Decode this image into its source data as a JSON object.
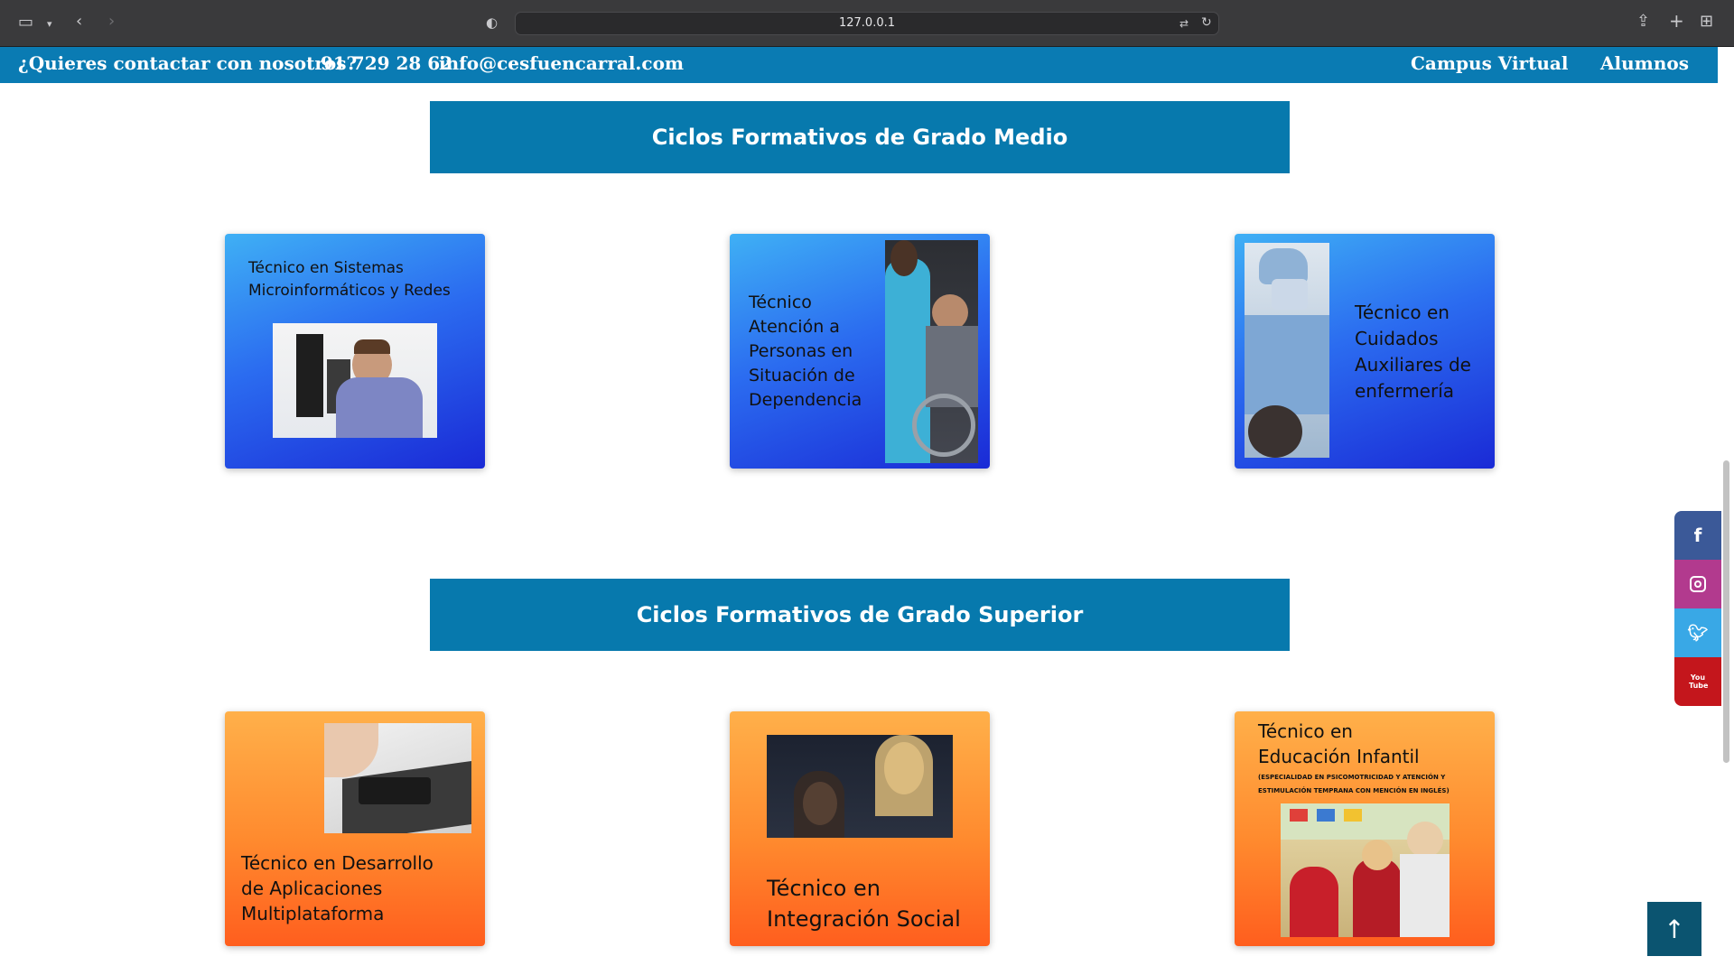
{
  "browser": {
    "url": "127.0.0.1"
  },
  "topbar": {
    "contact_question": "¿Quieres contactar con nosotros?",
    "phone": "91 729 28 62",
    "email": "info@cesfuencarral.com",
    "campus_virtual": "Campus Virtual",
    "alumnos": "Alumnos"
  },
  "sections": {
    "grado_medio": {
      "heading": "Ciclos Formativos de Grado Medio",
      "cards": [
        {
          "title_line1": "Técnico en Sistemas",
          "title_line2": "Microinformáticos y Redes"
        },
        {
          "lines": [
            "Técnico",
            "Atención a",
            "Personas en",
            "Situación de",
            "Dependencia"
          ]
        },
        {
          "lines": [
            "Técnico en",
            "Cuidados",
            "Auxiliares de",
            "enfermería"
          ]
        }
      ]
    },
    "grado_superior": {
      "heading": "Ciclos Formativos de Grado Superior",
      "cards": [
        {
          "lines": [
            "Técnico en Desarrollo",
            "de Aplicaciones",
            "Multiplataforma"
          ]
        },
        {
          "lines": [
            "Técnico en",
            "Integración Social"
          ]
        },
        {
          "lines": [
            "Técnico en",
            "Educación Infantil"
          ],
          "note_line1": "(ESPECIALIDAD EN PSICOMOTRICIDAD Y ATENCIÓN Y",
          "note_line2": "ESTIMULACIÓN TEMPRANA CON MENCIÓN EN INGLÉS)"
        }
      ]
    }
  },
  "social": {
    "facebook": "f",
    "instagram_icon": "instagram-icon",
    "twitter_icon": "twitter-icon",
    "youtube": "You Tube"
  },
  "colors": {
    "brand_blue": "#0779ad",
    "facebook": "#3b5998",
    "instagram": "#b23a8e",
    "twitter": "#39a8e6",
    "youtube": "#c4161c",
    "back_to_top": "#0b5470"
  }
}
